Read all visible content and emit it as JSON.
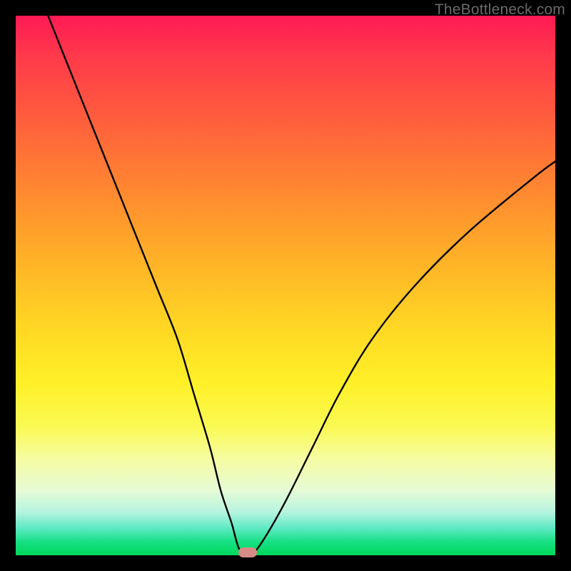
{
  "watermark": "TheBottleneck.com",
  "chart_data": {
    "type": "line",
    "title": "",
    "xlabel": "",
    "ylabel": "",
    "xlim": [
      0,
      100
    ],
    "ylim": [
      0,
      100
    ],
    "grid": false,
    "legend": false,
    "background": "vertical-gradient red→orange→yellow→green",
    "series": [
      {
        "name": "bottleneck-curve",
        "x": [
          6,
          10,
          14,
          18,
          22,
          26,
          30,
          33,
          36,
          38,
          40,
          41.5,
          43.5,
          46,
          50,
          55,
          60,
          66,
          74,
          84,
          96,
          100
        ],
        "y": [
          100,
          90,
          80,
          70,
          60,
          50,
          40,
          30,
          20,
          12,
          6,
          1,
          0,
          3,
          10,
          20,
          30,
          40,
          50,
          60,
          70,
          73
        ]
      }
    ],
    "marker": {
      "x": 43,
      "y": 0,
      "shape": "pill",
      "color": "#d88b87"
    }
  },
  "colors": {
    "frame": "#000000",
    "curve": "#000000",
    "watermark": "#6a6a6a",
    "marker": "#d88b87"
  }
}
